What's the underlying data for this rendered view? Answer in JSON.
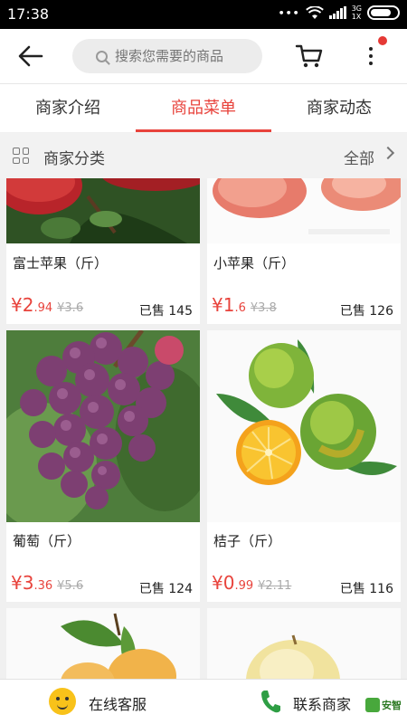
{
  "status_bar": {
    "time": "17:38",
    "network": "3G",
    "network2": "1X"
  },
  "header": {
    "search_placeholder": "搜索您需要的商品"
  },
  "tabs": [
    {
      "label": "商家介绍",
      "active": false
    },
    {
      "label": "商品菜单",
      "active": true
    },
    {
      "label": "商家动态",
      "active": false
    }
  ],
  "category_bar": {
    "label": "商家分类",
    "all": "全部"
  },
  "products": [
    {
      "name": "富士苹果（斤）",
      "price_int": "¥2",
      "price_dec": ".94",
      "orig_price": "¥3.6",
      "sold": "已售 145",
      "image": "red-apple-tree"
    },
    {
      "name": "小苹果（斤）",
      "price_int": "¥1",
      "price_dec": ".6",
      "orig_price": "¥3.8",
      "sold": "已售 126",
      "image": "small-apples"
    },
    {
      "name": "葡萄（斤）",
      "price_int": "¥3",
      "price_dec": ".36",
      "orig_price": "¥5.6",
      "sold": "已售 124",
      "image": "purple-grapes"
    },
    {
      "name": "桔子（斤）",
      "price_int": "¥0",
      "price_dec": ".99",
      "orig_price": "¥2.11",
      "sold": "已售 116",
      "image": "oranges"
    },
    {
      "name": "",
      "image": "orange-with-leaves"
    },
    {
      "name": "",
      "image": "pear"
    }
  ],
  "bottom_bar": {
    "customer_service": "在线客服",
    "contact": "联系商家"
  },
  "watermark": "安智",
  "colors": {
    "accent": "#e8433c",
    "status_bar": "#000000"
  }
}
